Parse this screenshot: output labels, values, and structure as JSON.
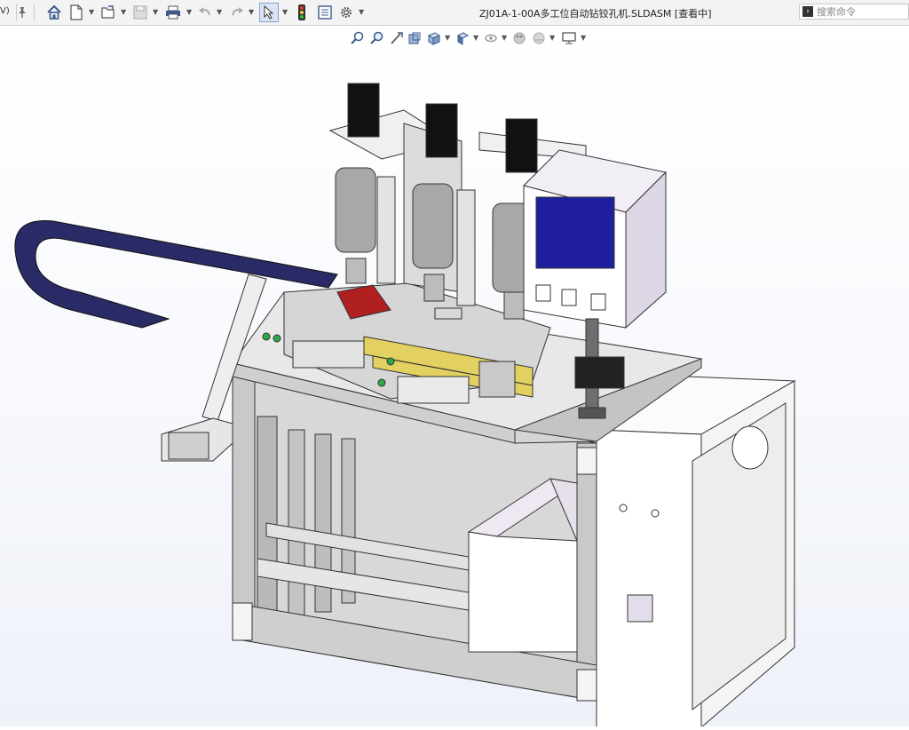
{
  "window": {
    "left_fragment": "V)",
    "title": "ZJ01A-1-00A多工位自动钻铰孔机.SLDASM [查看中]"
  },
  "toolbar": {
    "icons": [
      "pin-icon",
      "home-icon",
      "new-document-icon",
      "open-folder-icon",
      "save-icon",
      "print-icon",
      "undo-icon",
      "redo-icon",
      "select-arrow-icon",
      "traffic-light-icon",
      "file-properties-icon",
      "options-gear-icon"
    ]
  },
  "search": {
    "placeholder": "搜索命令"
  },
  "heads_up_toolbar": {
    "icons": [
      "zoom-to-fit-icon",
      "zoom-to-area-icon",
      "previous-view-icon",
      "section-view-icon",
      "view-orientation-icon",
      "display-style-icon",
      "hide-show-items-icon",
      "edit-appearance-icon",
      "apply-scene-icon",
      "view-settings-icon"
    ]
  },
  "colors": {
    "panel": "#e6e4ee",
    "frame": "#c9c9c9",
    "screen": "#1e1e9e",
    "cable_chain": "#2a2a66",
    "motor": "#111111",
    "rail_yellow": "#e2d060",
    "green_part": "#2aa84a",
    "red_part": "#b02020"
  }
}
